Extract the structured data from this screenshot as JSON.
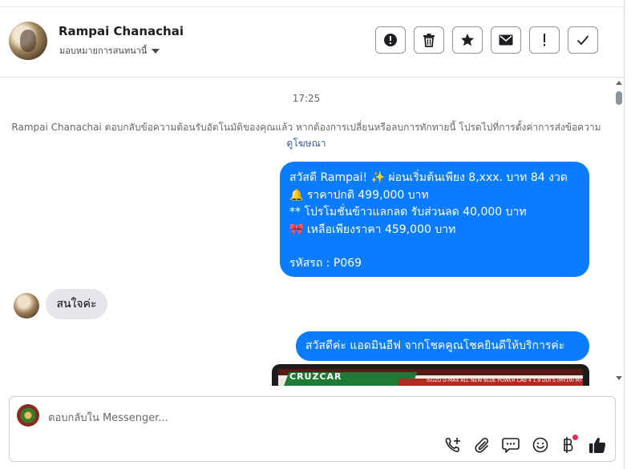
{
  "header": {
    "name": "Rampai Chanachai",
    "assign_label": "มอบหมายการสนทนานี้",
    "actions": [
      {
        "name": "report-button",
        "icon": "alert-circle-icon"
      },
      {
        "name": "delete-button",
        "icon": "trash-icon"
      },
      {
        "name": "star-button",
        "icon": "star-icon"
      },
      {
        "name": "mark-unread-button",
        "icon": "envelope-icon"
      },
      {
        "name": "important-button",
        "icon": "exclamation-icon"
      },
      {
        "name": "mark-done-button",
        "icon": "check-icon"
      }
    ]
  },
  "conversation": {
    "timestamp": "17:25",
    "system_note": "Rampai Chanachai ตอบกลับข้อความต้อนรับอัตโนมัติของคุณแล้ว หากต้องการเปลี่ยนหรือลบการทักทายนี้ โปรดไปที่การตั้งค่าการส่งข้อความ",
    "system_link": "ดูโฆษณา",
    "messages": [
      {
        "direction": "outgoing",
        "lines": [
          "สวัสดี Rampai! ✨  ผ่อนเริ่มต้นเพียง 8,xxx. บาท 84 งวด",
          "🔔 ราคาปกติ 499,000 บาท",
          "** โปรโมชั่นข้าวแลกลด รับส่วนลด 40,000 บาท",
          "🎀  เหลือเพียงราคา 459,000 บาท",
          "",
          " รหัสรถ : P069"
        ]
      },
      {
        "direction": "incoming",
        "text": "สนใจค่ะ"
      },
      {
        "direction": "outgoing",
        "text": "สวัสดีค่ะ แอดมินอีฟ จากโชคคูณโชคยินดีให้บริการค่ะ"
      },
      {
        "direction": "outgoing",
        "type": "image",
        "image_text": "CRUZCAR",
        "image_caption": "ISUZU D-MAX ALL NEW BLUE POWER CAB 4 1.9 DDI S (MY19) MT"
      }
    ]
  },
  "composer": {
    "placeholder": "ตอบกลับใน Messenger...",
    "tools": [
      {
        "name": "add-call-button",
        "icon": "phone-plus-icon"
      },
      {
        "name": "attach-button",
        "icon": "paperclip-icon"
      },
      {
        "name": "saved-replies-button",
        "icon": "chat-bubble-icon"
      },
      {
        "name": "emoji-button",
        "icon": "smiley-icon"
      },
      {
        "name": "payment-button",
        "icon": "baht-icon",
        "badge": true
      },
      {
        "name": "like-button",
        "icon": "thumbs-up-icon"
      }
    ]
  },
  "colors": {
    "outgoing_bubble": "#0a7cff",
    "incoming_bubble": "#e4e6eb",
    "link": "#385898",
    "badge": "#f02849"
  }
}
